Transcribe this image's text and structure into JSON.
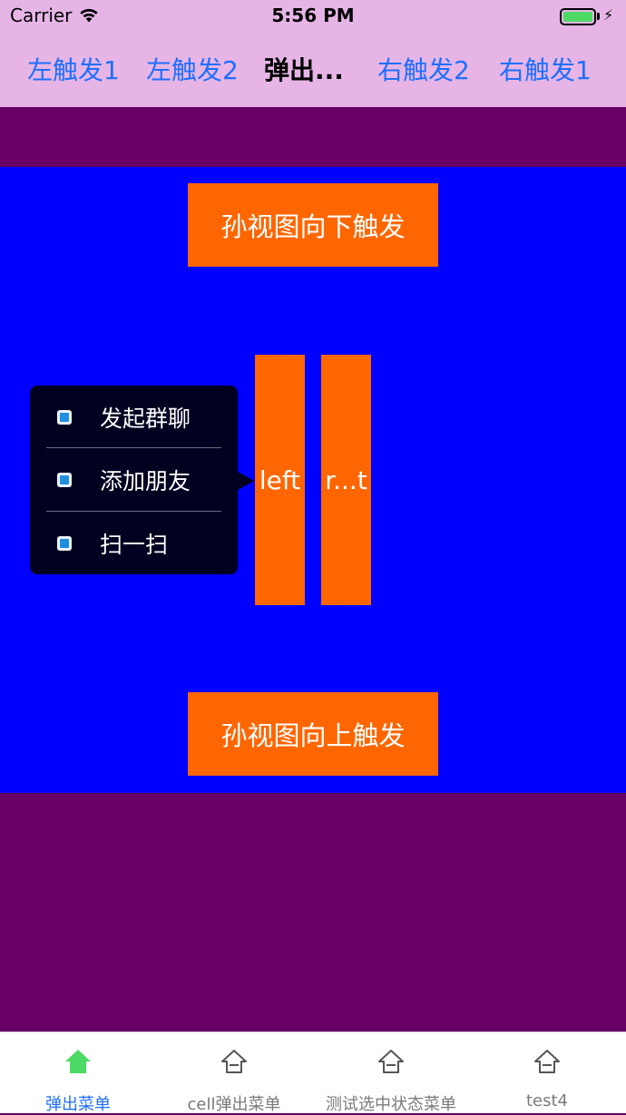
{
  "status_bar": {
    "carrier": "Carrier",
    "time": "5:56 PM",
    "wifi_icon": "wifi-icon",
    "battery_icon": "battery-icon"
  },
  "nav_bar": {
    "left_items": [
      "左触发1",
      "左触发2"
    ],
    "title": "弹出...",
    "right_items": [
      "右触发2",
      "右触发1"
    ],
    "colors": {
      "tint": "#1e6fff",
      "background": "#e6b5e6"
    }
  },
  "content": {
    "top_button": "孙视图向下触发",
    "bottom_button": "孙视图向上触发",
    "left_button": "left",
    "right_button": "r...t",
    "colors": {
      "panel": "#0000ff",
      "button": "#ff6600",
      "page": "#690066"
    }
  },
  "popup_menu": {
    "items": [
      {
        "label": "发起群聊",
        "icon": "edit-icon"
      },
      {
        "label": "添加朋友",
        "icon": "edit-icon"
      },
      {
        "label": "扫一扫",
        "icon": "edit-icon"
      }
    ]
  },
  "tab_bar": {
    "active_index": 0,
    "tabs": [
      {
        "label": "弹出菜单",
        "icon": "home-icon"
      },
      {
        "label": "cell弹出菜单",
        "icon": "home-icon"
      },
      {
        "label": "测试选中状态菜单",
        "icon": "home-icon"
      },
      {
        "label": "test4",
        "icon": "home-icon"
      }
    ]
  }
}
